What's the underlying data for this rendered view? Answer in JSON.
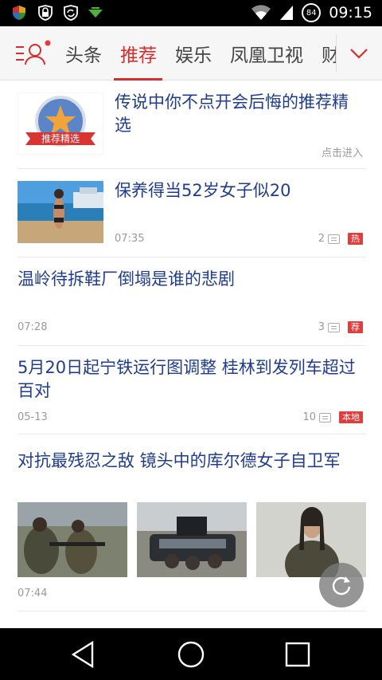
{
  "status_bar": {
    "time": "09:15",
    "battery": "84",
    "icons": [
      "shield-icon",
      "lock-icon",
      "sync-shield-icon",
      "download-icon",
      "wifi-icon",
      "signal-icon"
    ]
  },
  "header": {
    "tabs": [
      {
        "label": "头条",
        "active": false
      },
      {
        "label": "推荐",
        "active": true
      },
      {
        "label": "娱乐",
        "active": false
      },
      {
        "label": "凤凰卫视",
        "active": false
      },
      {
        "label": "财",
        "active": false
      }
    ],
    "accent_color": "#d72d2d"
  },
  "feed": {
    "items": [
      {
        "title": "传说中你不点开会后悔的推荐精选",
        "badge_text": "推荐精选",
        "action": "点击进入"
      },
      {
        "title": "保养得当52岁女子似20",
        "time": "07:35",
        "comments": "2",
        "tag": "热"
      },
      {
        "title": "温岭待拆鞋厂倒塌是谁的悲剧",
        "time": "07:28",
        "comments": "3",
        "tag": "荐"
      },
      {
        "title": "5月20日起宁铁运行图调整 桂林到发列车超过百对",
        "time": "05-13",
        "comments": "10",
        "tag": "本地"
      },
      {
        "title": "对抗最残忍之敌 镜头中的库尔德女子自卫军",
        "time": "07:44"
      }
    ]
  },
  "nav": {
    "buttons": [
      "back-icon",
      "home-icon",
      "recents-icon"
    ]
  }
}
